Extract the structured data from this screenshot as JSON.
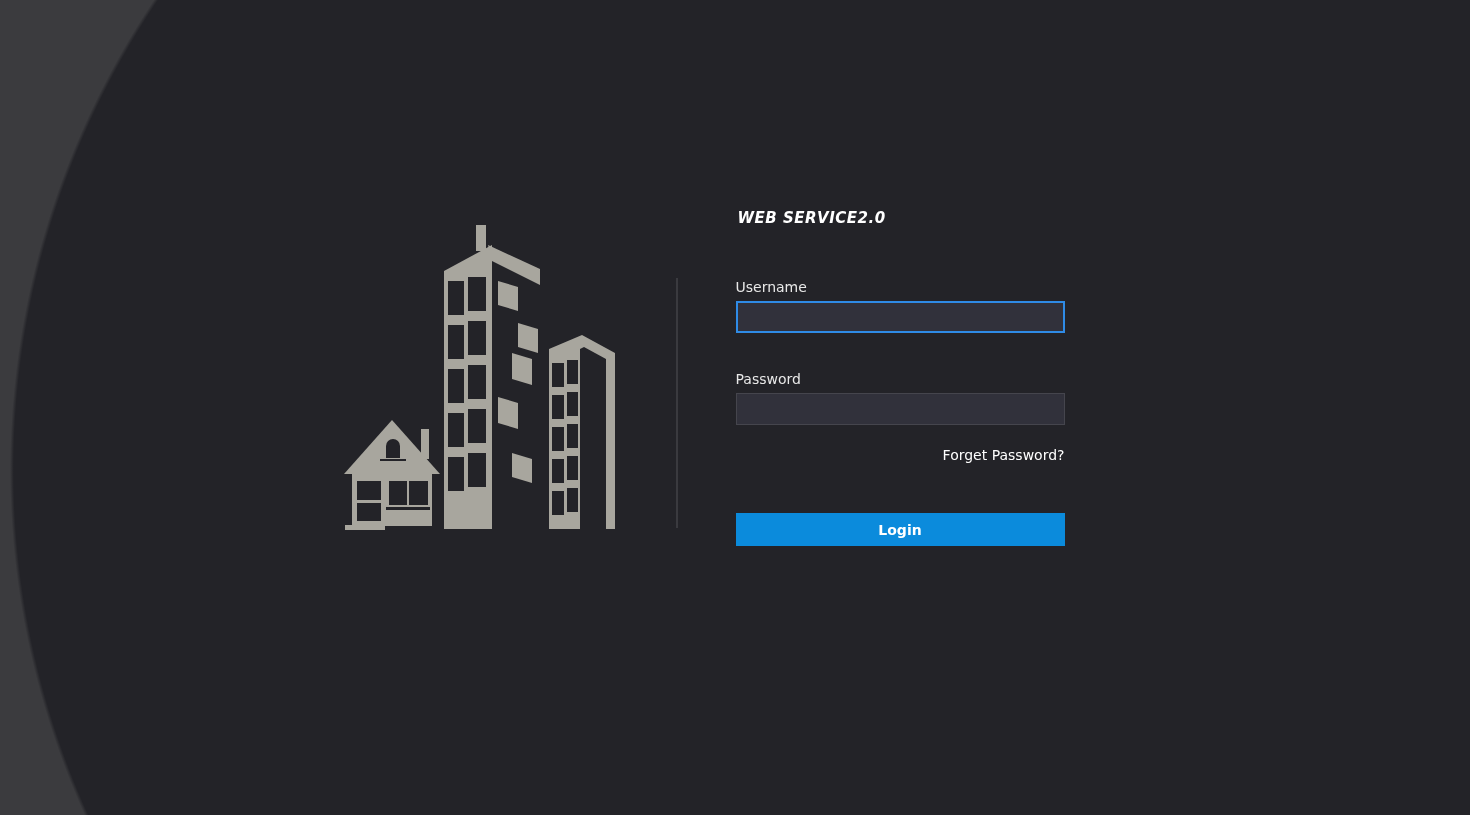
{
  "title": "WEB SERVICE2.0",
  "fields": [
    {
      "label": "Username",
      "focused": true
    },
    {
      "label": "Password",
      "focused": false
    }
  ],
  "forgot_link": "Forget Password?",
  "login_button": "Login"
}
